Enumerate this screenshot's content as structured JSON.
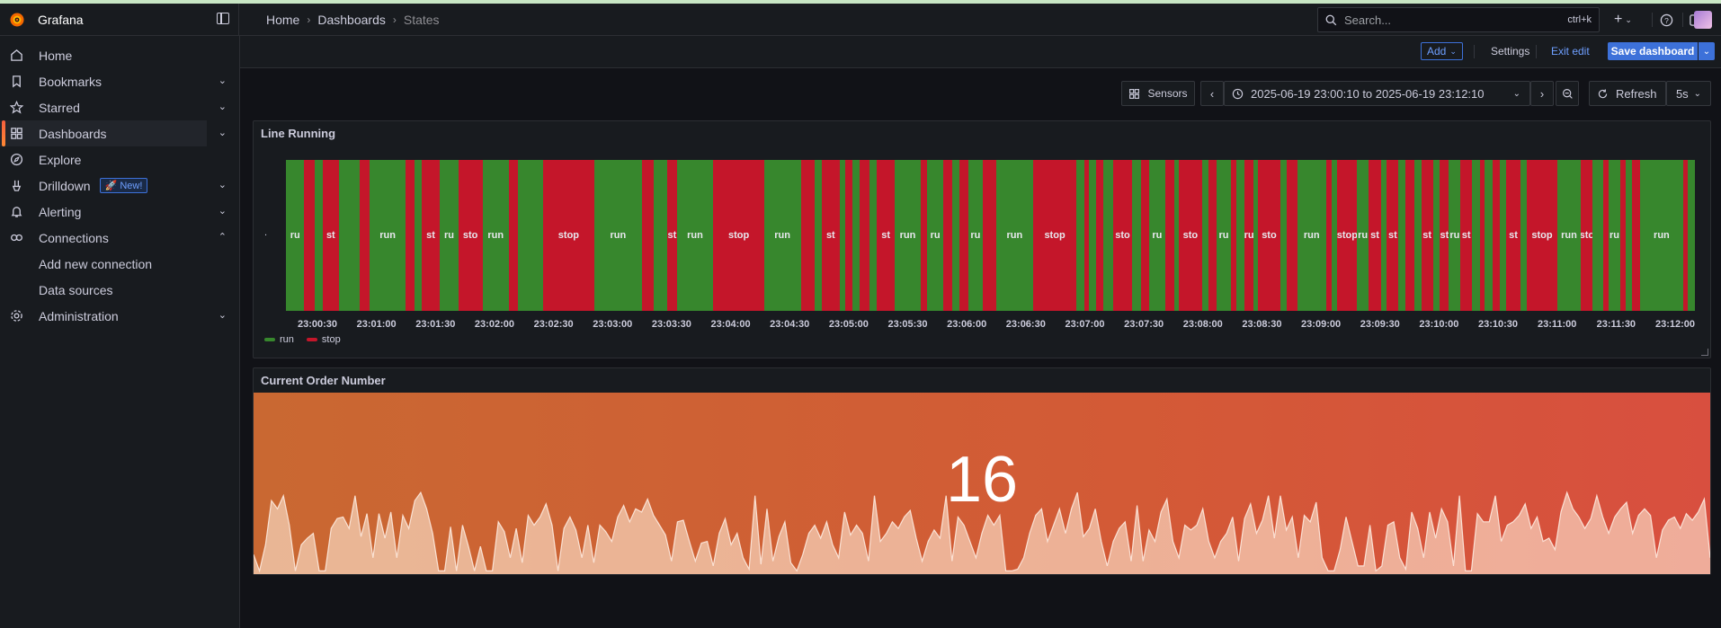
{
  "app": {
    "name": "Grafana"
  },
  "breadcrumbs": [
    "Home",
    "Dashboards",
    "States"
  ],
  "search": {
    "placeholder": "Search...",
    "shortcut": "ctrl+k"
  },
  "sidebar": {
    "items": [
      {
        "label": "Home",
        "icon": "home-icon"
      },
      {
        "label": "Bookmarks",
        "icon": "bookmark-icon"
      },
      {
        "label": "Starred",
        "icon": "star-icon"
      },
      {
        "label": "Dashboards",
        "icon": "apps-icon"
      },
      {
        "label": "Explore",
        "icon": "compass-icon"
      },
      {
        "label": "Drilldown",
        "icon": "drilldown-icon",
        "badge": "New!"
      },
      {
        "label": "Alerting",
        "icon": "bell-icon"
      },
      {
        "label": "Connections",
        "icon": "connections-icon"
      },
      {
        "label": "Add new connection"
      },
      {
        "label": "Data sources"
      },
      {
        "label": "Administration",
        "icon": "cog-icon"
      }
    ]
  },
  "editbar": {
    "add": "Add",
    "settings": "Settings",
    "exit": "Exit edit",
    "save": "Save dashboard"
  },
  "controls": {
    "sensors": "Sensors",
    "time_range": "2025-06-19 23:00:10 to 2025-06-19 23:12:10",
    "refresh": "Refresh",
    "interval": "5s"
  },
  "panels": {
    "state_timeline": {
      "title": "Line Running",
      "row_label": ".",
      "legend": [
        {
          "label": "run",
          "color": "#37872d"
        },
        {
          "label": "stop",
          "color": "#c4162a"
        }
      ]
    },
    "stat": {
      "title": "Current Order Number",
      "value": "16"
    }
  },
  "chart_data": [
    {
      "type": "state-timeline",
      "title": "Line Running",
      "x_range": [
        "23:00:10",
        "23:12:10"
      ],
      "x_ticks": [
        "23:00:30",
        "23:01:00",
        "23:01:30",
        "23:02:00",
        "23:02:30",
        "23:03:00",
        "23:03:30",
        "23:04:00",
        "23:04:30",
        "23:05:00",
        "23:05:30",
        "23:06:00",
        "23:06:30",
        "23:07:00",
        "23:07:30",
        "23:08:00",
        "23:08:30",
        "23:09:00",
        "23:09:30",
        "23:10:00",
        "23:10:30",
        "23:11:00",
        "23:11:30",
        "23:12:00"
      ],
      "states": {
        "run": "#37872d",
        "stop": "#c4162a"
      },
      "segments": [
        [
          "run",
          0.0,
          8.0,
          "ru"
        ],
        [
          "stop",
          8.0,
          12.5,
          ""
        ],
        [
          "run",
          12.5,
          16.0,
          ""
        ],
        [
          "stop",
          16.0,
          23.0,
          "st"
        ],
        [
          "run",
          23.0,
          32.0,
          ""
        ],
        [
          "stop",
          32.0,
          36.5,
          ""
        ],
        [
          "run",
          36.5,
          52.0,
          "run"
        ],
        [
          "stop",
          52.0,
          56.0,
          ""
        ],
        [
          "run",
          56.0,
          59.0,
          ""
        ],
        [
          "stop",
          59.0,
          67.0,
          "st"
        ],
        [
          "run",
          67.0,
          75.0,
          "ru"
        ],
        [
          "stop",
          75.0,
          85.5,
          "sto"
        ],
        [
          "run",
          85.5,
          97.0,
          "run"
        ],
        [
          "stop",
          97.0,
          101.0,
          ""
        ],
        [
          "run",
          101.0,
          112.0,
          ""
        ],
        [
          "stop",
          112.0,
          134.0,
          "stop"
        ],
        [
          "run",
          134.0,
          155.0,
          "run"
        ],
        [
          "stop",
          155.0,
          160.0,
          ""
        ],
        [
          "run",
          160.0,
          166.0,
          ""
        ],
        [
          "stop",
          166.0,
          170.0,
          "st"
        ],
        [
          "run",
          170.0,
          186.0,
          "run"
        ],
        [
          "stop",
          186.0,
          208.0,
          "stop"
        ],
        [
          "run",
          208.0,
          224.0,
          "run"
        ],
        [
          "stop",
          224.0,
          230.0,
          ""
        ],
        [
          "run",
          230.0,
          233.0,
          ""
        ],
        [
          "stop",
          233.0,
          241.0,
          "st"
        ],
        [
          "run",
          241.0,
          243.5,
          ""
        ],
        [
          "stop",
          243.5,
          246.5,
          ""
        ],
        [
          "run",
          246.5,
          249.5,
          ""
        ],
        [
          "stop",
          249.5,
          254.0,
          ""
        ],
        [
          "run",
          254.0,
          257.0,
          ""
        ],
        [
          "stop",
          257.0,
          265.0,
          "st"
        ],
        [
          "run",
          265.0,
          276.0,
          "run"
        ],
        [
          "stop",
          276.0,
          279.0,
          ""
        ],
        [
          "run",
          279.0,
          286.0,
          "ru"
        ],
        [
          "stop",
          286.0,
          290.0,
          ""
        ],
        [
          "run",
          290.0,
          293.0,
          ""
        ],
        [
          "stop",
          293.0,
          297.0,
          ""
        ],
        [
          "run",
          297.0,
          303.0,
          "ru"
        ],
        [
          "stop",
          303.0,
          309.0,
          ""
        ],
        [
          "run",
          309.0,
          325.0,
          "run"
        ],
        [
          "stop",
          325.0,
          344.0,
          "stop"
        ],
        [
          "run",
          344.0,
          347.5,
          ""
        ],
        [
          "stop",
          347.5,
          349.5,
          ""
        ],
        [
          "run",
          349.5,
          352.5,
          ""
        ],
        [
          "stop",
          352.5,
          355.5,
          ""
        ],
        [
          "run",
          355.5,
          360.0,
          ""
        ],
        [
          "stop",
          360.0,
          368.0,
          "sto"
        ],
        [
          "run",
          368.0,
          372.0,
          ""
        ],
        [
          "stop",
          372.0,
          375.5,
          ""
        ],
        [
          "run",
          375.5,
          382.5,
          "ru"
        ],
        [
          "stop",
          382.5,
          386.5,
          ""
        ],
        [
          "run",
          386.5,
          388.5,
          ""
        ],
        [
          "stop",
          388.5,
          398.5,
          "sto"
        ],
        [
          "run",
          398.5,
          401.5,
          ""
        ],
        [
          "stop",
          401.5,
          405.0,
          ""
        ],
        [
          "run",
          405.0,
          411.0,
          "ru"
        ],
        [
          "stop",
          411.0,
          413.5,
          ""
        ],
        [
          "run",
          413.5,
          417.0,
          ""
        ],
        [
          "stop",
          417.0,
          421.0,
          "ru"
        ],
        [
          "run",
          421.0,
          423.0,
          ""
        ],
        [
          "stop",
          423.0,
          432.5,
          "sto"
        ],
        [
          "run",
          432.5,
          435.5,
          ""
        ],
        [
          "stop",
          435.5,
          440.0,
          ""
        ],
        [
          "run",
          440.0,
          452.5,
          "run"
        ],
        [
          "stop",
          452.5,
          455.0,
          ""
        ],
        [
          "run",
          455.0,
          457.5,
          ""
        ],
        [
          "stop",
          457.5,
          466.0,
          "stop"
        ],
        [
          "run",
          466.0,
          471.0,
          "ru"
        ],
        [
          "stop",
          471.0,
          476.5,
          "st"
        ],
        [
          "run",
          476.5,
          479.0,
          ""
        ],
        [
          "stop",
          479.0,
          484.0,
          "st"
        ],
        [
          "run",
          484.0,
          487.0,
          ""
        ],
        [
          "stop",
          487.0,
          491.0,
          ""
        ],
        [
          "run",
          491.0,
          494.0,
          ""
        ],
        [
          "stop",
          494.0,
          499.0,
          "st"
        ],
        [
          "run",
          499.0,
          502.0,
          ""
        ],
        [
          "stop",
          502.0,
          506.0,
          "st"
        ],
        [
          "run",
          506.0,
          511.0,
          "ru"
        ],
        [
          "stop",
          511.0,
          516.0,
          "st"
        ],
        [
          "run",
          516.0,
          519.5,
          ""
        ],
        [
          "stop",
          519.5,
          521.5,
          ""
        ],
        [
          "run",
          521.5,
          525.0,
          ""
        ],
        [
          "stop",
          525.0,
          528.0,
          ""
        ],
        [
          "run",
          528.0,
          531.0,
          ""
        ],
        [
          "stop",
          531.0,
          537.0,
          "st"
        ],
        [
          "run",
          537.0,
          540.0,
          ""
        ],
        [
          "stop",
          540.0,
          553.0,
          "stop"
        ],
        [
          "run",
          553.0,
          563.5,
          "run"
        ],
        [
          "stop",
          563.5,
          568.5,
          "sto"
        ],
        [
          "run",
          568.5,
          573.0,
          ""
        ],
        [
          "stop",
          573.0,
          575.5,
          ""
        ],
        [
          "run",
          575.5,
          580.5,
          "ru"
        ],
        [
          "stop",
          580.5,
          583.0,
          ""
        ],
        [
          "run",
          583.0,
          585.5,
          ""
        ],
        [
          "stop",
          585.5,
          589.0,
          ""
        ],
        [
          "run",
          589.0,
          608.0,
          "run"
        ],
        [
          "stop",
          608.0,
          610.0,
          ""
        ],
        [
          "run",
          610.0,
          613.0,
          ""
        ]
      ]
    },
    {
      "type": "area",
      "title": "Current Order Number",
      "value": 16,
      "ylim": [
        0,
        100
      ],
      "values": [
        12,
        2,
        18,
        45,
        40,
        48,
        30,
        2,
        18,
        22,
        25,
        2,
        2,
        28,
        34,
        35,
        28,
        48,
        23,
        37,
        10,
        37,
        22,
        38,
        10,
        36,
        28,
        45,
        50,
        40,
        25,
        2,
        2,
        29,
        2,
        30,
        17,
        2,
        17,
        2,
        2,
        32,
        26,
        10,
        28,
        7,
        36,
        30,
        35,
        43,
        30,
        2,
        28,
        35,
        27,
        10,
        30,
        7,
        30,
        26,
        20,
        35,
        42,
        32,
        40,
        38,
        46,
        36,
        30,
        24,
        8,
        32,
        33,
        20,
        8,
        19,
        20,
        5,
        25,
        34,
        18,
        25,
        10,
        3,
        48,
        6,
        40,
        8,
        23,
        32,
        7,
        2,
        12,
        25,
        30,
        22,
        32,
        18,
        10,
        38,
        24,
        30,
        25,
        8,
        48,
        20,
        25,
        32,
        28,
        35,
        39,
        22,
        8,
        20,
        27,
        22,
        48,
        8,
        35,
        30,
        20,
        10,
        25,
        36,
        30,
        36,
        2,
        2,
        3,
        10,
        25,
        36,
        40,
        20,
        30,
        40,
        25,
        40,
        50,
        23,
        28,
        40,
        20,
        5,
        20,
        28,
        32,
        8,
        42,
        8,
        27,
        20,
        38,
        46,
        20,
        10,
        30,
        27,
        30,
        40,
        20,
        10,
        20,
        25,
        35,
        8,
        34,
        43,
        25,
        33,
        48,
        22,
        48,
        27,
        35,
        10,
        36,
        32,
        44,
        10,
        2,
        2,
        15,
        35,
        20,
        5,
        5,
        30,
        2,
        5,
        30,
        32,
        10,
        3,
        38,
        28,
        10,
        38,
        22,
        40,
        32,
        5,
        48,
        2,
        2,
        37,
        32,
        32,
        48,
        20,
        30,
        32,
        36,
        43,
        28,
        35,
        20,
        22,
        15,
        38,
        50,
        40,
        35,
        28,
        34,
        48,
        35,
        25,
        35,
        40,
        44,
        25,
        36,
        40,
        36,
        10,
        27,
        33,
        35,
        28,
        37,
        33,
        38,
        46,
        10
      ]
    }
  ]
}
